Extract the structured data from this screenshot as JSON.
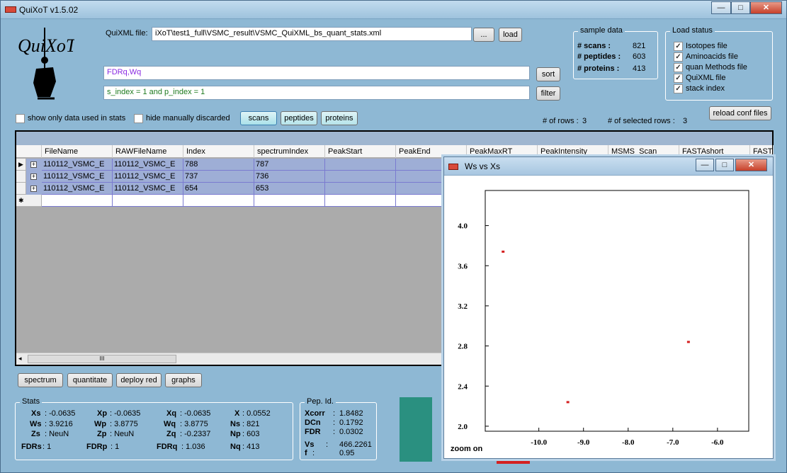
{
  "window": {
    "title": "QuiXoT v1.5.02",
    "min": "—",
    "max": "□",
    "close": "✕"
  },
  "file": {
    "label": "QuiXML file:",
    "path": "iXoT\\test1_full\\VSMC_result\\VSMC_QuiXML_bs_quant_stats.xml",
    "browse": "...",
    "load": "load"
  },
  "sort": {
    "value": "FDRq,Wq",
    "button": "sort"
  },
  "filter": {
    "value": "s_index = 1 and p_index = 1",
    "button": "filter"
  },
  "sample": {
    "title": "sample data",
    "scans_label": "# scans :",
    "scans": "821",
    "peptides_label": "# peptides :",
    "peptides": "603",
    "proteins_label": "# proteins :",
    "proteins": "413"
  },
  "load_status": {
    "title": "Load status",
    "items": [
      {
        "label": "Isotopes file",
        "checked": true
      },
      {
        "label": "Aminoacids file",
        "checked": true
      },
      {
        "label": "quan Methods file",
        "checked": true
      },
      {
        "label": "QuiXML file",
        "checked": true
      },
      {
        "label": "stack index",
        "checked": true
      }
    ]
  },
  "options": {
    "show_only": "show only data used in stats",
    "hide_discarded": "hide manually discarded"
  },
  "views": {
    "scans": "scans",
    "peptides": "peptides",
    "proteins": "proteins"
  },
  "counts": {
    "rows_label": "# of rows :",
    "rows": "3",
    "selected_label": "# of  selected rows :",
    "selected": "3"
  },
  "reload": "reload conf files",
  "grid": {
    "columns": [
      "FileName",
      "RAWFileName",
      "Index",
      "spectrumIndex",
      "PeakStart",
      "PeakEnd",
      "PeakMaxRT",
      "PeakIntensity",
      "MSMS_Scan",
      "FASTAshort",
      "FASTA"
    ],
    "rows": [
      [
        "110112_VSMC_E",
        "110112_VSMC_E",
        "788",
        "787"
      ],
      [
        "110112_VSMC_E",
        "110112_VSMC_E",
        "737",
        "736"
      ],
      [
        "110112_VSMC_E",
        "110112_VSMC_E",
        "654",
        "653"
      ]
    ],
    "current_marker": "▶",
    "new_marker": "✱",
    "scroll_grip": "III"
  },
  "actions": {
    "spectrum": "spectrum",
    "quantitate": "quantitate",
    "deploy": "deploy red",
    "graphs": "graphs"
  },
  "stats": {
    "title": "Stats",
    "rows": [
      [
        [
          "Xs",
          ": -0.0635"
        ],
        [
          "Xp",
          ": -0.0635"
        ],
        [
          "Xq",
          ": -0.0635"
        ],
        [
          "X",
          ": 0.0552"
        ]
      ],
      [
        [
          "Ws",
          ": 3.9216"
        ],
        [
          "Wp",
          ": 3.8775"
        ],
        [
          "Wq",
          ": 3.8775"
        ],
        [
          "Ns",
          ": 821"
        ]
      ],
      [
        [
          "Zs",
          ": NeuN"
        ],
        [
          "Zp",
          ": NeuN"
        ],
        [
          "Zq",
          ": -0.2337"
        ],
        [
          "Np",
          ": 603"
        ]
      ],
      [
        [
          "FDRs",
          ": 1"
        ],
        [
          "FDRp",
          ": 1"
        ],
        [
          "FDRq",
          ": 1.036"
        ],
        [
          "Nq",
          ": 413"
        ]
      ]
    ]
  },
  "pep": {
    "title": "Pep. Id.",
    "rows": [
      [
        "Xcorr",
        ":",
        "1.8482"
      ],
      [
        "DCn",
        ":",
        "0.1792"
      ],
      [
        "FDR",
        ":",
        "0.0302"
      ],
      [
        "Vs",
        ":",
        "466.2261"
      ],
      [
        "f",
        ":",
        "0.95"
      ]
    ]
  },
  "accent": {
    "teal": "#2a9080",
    "red": "#d42020"
  },
  "plot_window": {
    "title": "Ws vs Xs",
    "zoom": "zoom on"
  },
  "chart_data": {
    "type": "scatter",
    "title": "",
    "xlabel": "",
    "ylabel": "",
    "xlim": [
      -11.2,
      -5.3
    ],
    "ylim": [
      1.95,
      4.35
    ],
    "xticks": [
      -10.0,
      -9.0,
      -8.0,
      -7.0,
      -6.0
    ],
    "yticks": [
      2.0,
      2.4,
      2.8,
      3.2,
      3.6,
      4.0
    ],
    "xtick_labels": [
      "-10.0",
      "-9.0",
      "-8.0",
      "-7.0",
      "-6.0"
    ],
    "ytick_labels": [
      "2.0",
      "2.4",
      "2.8",
      "3.2",
      "3.6",
      "4.0"
    ],
    "series": [
      {
        "color": "#d42020",
        "x": [
          -10.8,
          -9.35,
          -6.65
        ],
        "y": [
          3.74,
          2.24,
          2.84
        ]
      }
    ],
    "grid": false,
    "legend": "none"
  }
}
